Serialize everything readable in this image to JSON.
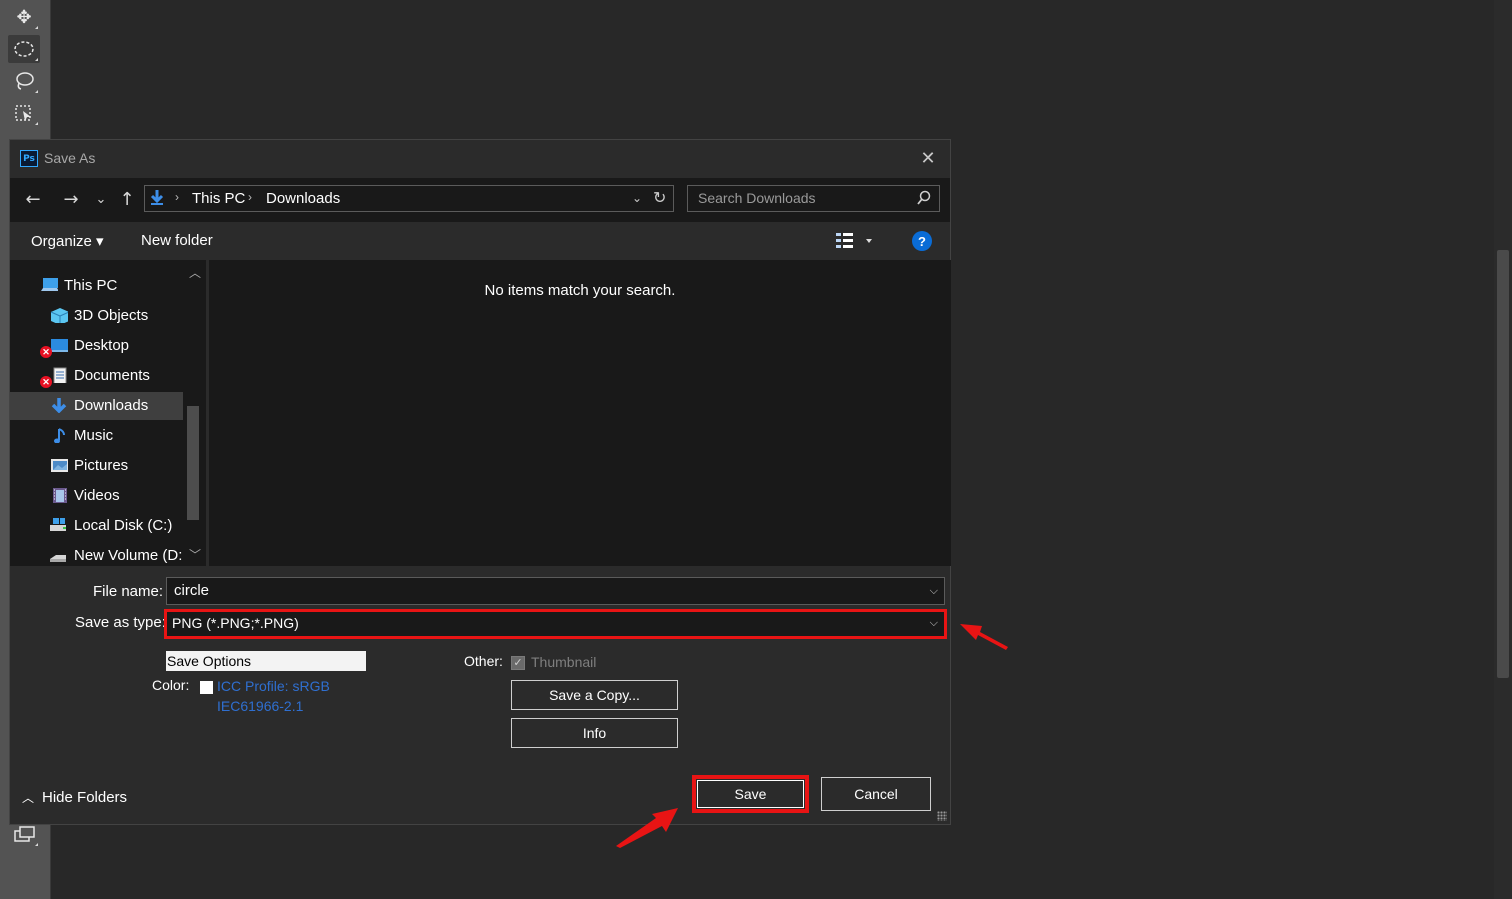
{
  "dialog": {
    "title": "Save As",
    "app_icon_text": "Ps",
    "close_glyph": "✕"
  },
  "nav": {
    "back_glyph": "←",
    "forward_glyph": "→",
    "recent_glyph": "⌄",
    "up_glyph": "↑",
    "breadcrumb": [
      "This PC",
      "Downloads"
    ],
    "refresh_glyph": "↻",
    "search_placeholder": "Search Downloads"
  },
  "toolbar": {
    "organize_label": "Organize ▾",
    "new_folder_label": "New folder",
    "help_label": "?"
  },
  "tree": {
    "items": [
      {
        "label": "This PC",
        "icon": "computer-icon"
      },
      {
        "label": "3D Objects",
        "icon": "cube-icon"
      },
      {
        "label": "Desktop",
        "icon": "desktop-icon",
        "error": true
      },
      {
        "label": "Documents",
        "icon": "documents-icon",
        "error": true
      },
      {
        "label": "Downloads",
        "icon": "download-arrow-icon",
        "selected": true
      },
      {
        "label": "Music",
        "icon": "music-note-icon"
      },
      {
        "label": "Pictures",
        "icon": "pictures-icon"
      },
      {
        "label": "Videos",
        "icon": "film-icon"
      },
      {
        "label": "Local Disk (C:)",
        "icon": "drive-icon"
      },
      {
        "label": "New Volume (D:",
        "icon": "drive-icon"
      }
    ]
  },
  "file_list": {
    "empty_message": "No items match your search."
  },
  "form": {
    "file_name_label": "File name:",
    "file_name_value": "circle",
    "save_as_type_label": "Save as type:",
    "save_as_type_value": "PNG (*.PNG;*.PNG)",
    "save_options_title": "Save Options",
    "color_label": "Color:",
    "icc_line1": "ICC Profile:  sRGB",
    "icc_line2": "IEC61966-2.1",
    "other_label": "Other:",
    "thumbnail_label": "Thumbnail",
    "save_copy_label": "Save a Copy...",
    "info_label": "Info"
  },
  "footer": {
    "hide_folders_label": "Hide Folders",
    "save_label": "Save",
    "cancel_label": "Cancel"
  },
  "colors": {
    "annotation_red": "#e81414",
    "dialog_bg": "#2b2b2b",
    "field_bg": "#191919",
    "link_blue": "#2f6fd0"
  }
}
